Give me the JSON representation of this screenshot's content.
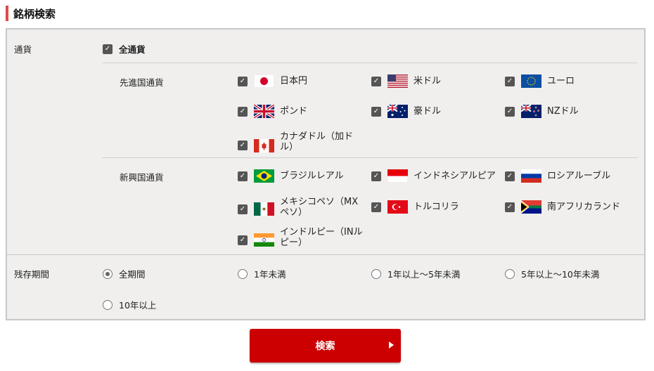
{
  "page_title": "銘柄検索",
  "currency": {
    "label": "通貨",
    "all_label": "全通貨",
    "all_checked": true,
    "groups": [
      {
        "label": "先進国通貨",
        "items": [
          {
            "name": "日本円",
            "flag": "jp-flag",
            "checked": true
          },
          {
            "name": "米ドル",
            "flag": "us-flag",
            "checked": true
          },
          {
            "name": "ユーロ",
            "flag": "eu-flag",
            "checked": true
          },
          {
            "name": "ポンド",
            "flag": "uk-flag",
            "checked": true
          },
          {
            "name": "豪ドル",
            "flag": "au-flag",
            "checked": true
          },
          {
            "name": "NZドル",
            "flag": "nz-flag",
            "checked": true
          },
          {
            "name": "カナダドル（加ドル）",
            "flag": "ca-flag",
            "checked": true
          }
        ]
      },
      {
        "label": "新興国通貨",
        "items": [
          {
            "name": "ブラジルレアル",
            "flag": "br-flag",
            "checked": true
          },
          {
            "name": "インドネシアルピア",
            "flag": "id-flag",
            "checked": true
          },
          {
            "name": "ロシアルーブル",
            "flag": "ru-flag",
            "checked": true
          },
          {
            "name": "メキシコペソ（MXペソ）",
            "flag": "mx-flag",
            "checked": true
          },
          {
            "name": "トルコリラ",
            "flag": "tr-flag",
            "checked": true
          },
          {
            "name": "南アフリカランド",
            "flag": "za-flag",
            "checked": true
          },
          {
            "name": "インドルピー（INルピー）",
            "flag": "in-flag",
            "checked": true
          }
        ]
      }
    ]
  },
  "term": {
    "label": "残存期間",
    "options": [
      {
        "label": "全期間",
        "selected": true
      },
      {
        "label": "1年未満",
        "selected": false
      },
      {
        "label": "1年以上～5年未満",
        "selected": false
      },
      {
        "label": "5年以上～10年未満",
        "selected": false
      },
      {
        "label": "10年以上",
        "selected": false
      }
    ]
  },
  "search_button": "検索",
  "colors": {
    "accent": "#e04a4a",
    "button": "#cc0000",
    "panel": "#f0efee"
  }
}
